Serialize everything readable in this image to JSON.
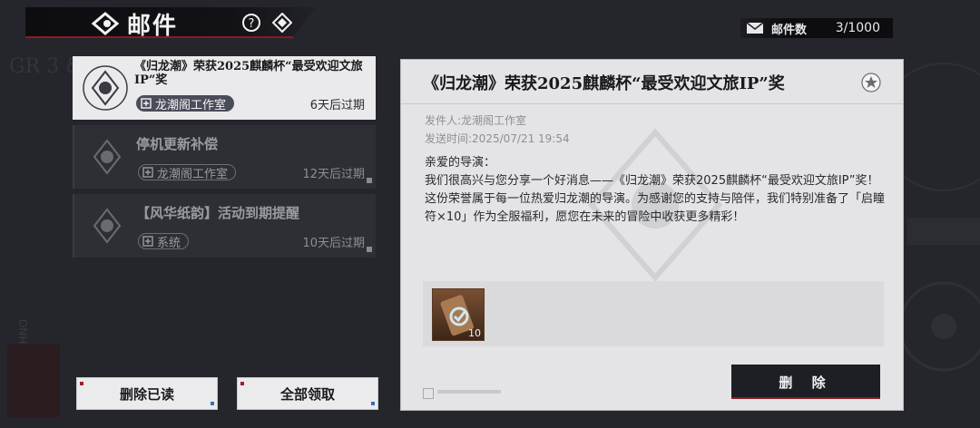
{
  "header": {
    "title": "邮件",
    "back_icon": "back-eye-icon",
    "help_icon": "question-circle-icon",
    "diamond_icon": "diamond-icon"
  },
  "mail_count": {
    "label": "邮件数",
    "value": "3/1000",
    "icon": "envelope-icon"
  },
  "mails": [
    {
      "title": "《归龙潮》荣获2025麒麟杯“最受欢迎文旅IP”奖",
      "sender": "龙潮阁工作室",
      "expire": "6天后过期",
      "active": true
    },
    {
      "title": "停机更新补偿",
      "sender": "龙潮阁工作室",
      "expire": "12天后过期",
      "active": false
    },
    {
      "title": "【风华纸韵】活动到期提醒",
      "sender": "系统",
      "expire": "10天后过期",
      "active": false
    }
  ],
  "buttons": {
    "delete_read": "删除已读",
    "claim_all": "全部领取",
    "delete": "删 除"
  },
  "detail": {
    "title": "《归龙潮》荣获2025麒麟杯“最受欢迎文旅IP”奖",
    "sender_line": "发件人:龙潮阁工作室",
    "time_line": "发送时间:2025/07/21 19:54",
    "greeting": "亲爱的导演：",
    "paragraph1": "我们很高兴与您分享一个好消息——《归龙潮》荣获2025麒麟杯“最受欢迎文旅IP”奖！",
    "paragraph2": "这份荣誉属于每一位热爱归龙潮的导演。为感谢您的支持与陪伴，我们特别准备了「启瞳符×10」作为全服福利，愿您在未来的冒险中收获更多精彩！",
    "attachment_qty": "10",
    "attachment_icon": "talisman-item-icon",
    "star_icon": "star-circle-icon"
  },
  "colors": {
    "accent_red": "#8a1b22",
    "background": "#25262c",
    "panel": "#e4e4e6"
  }
}
